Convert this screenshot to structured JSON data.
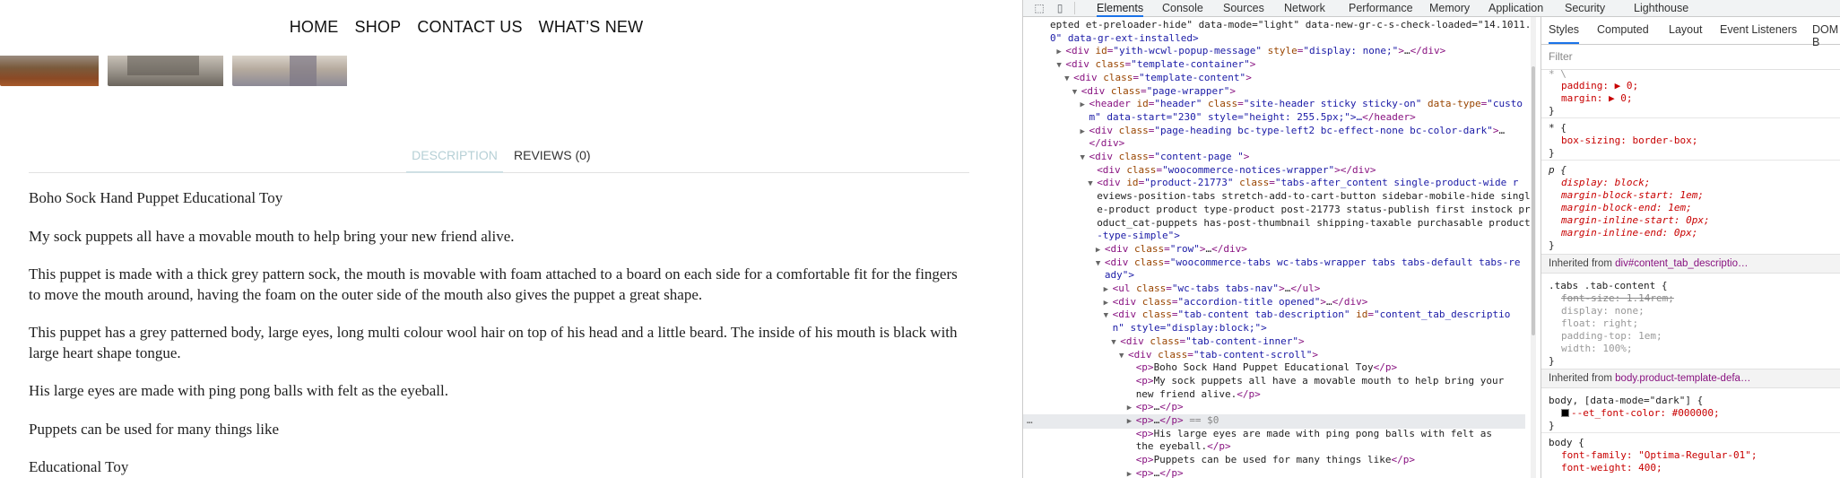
{
  "site": {
    "nav": [
      "HOME",
      "SHOP",
      "CONTACT US",
      "WHAT’S NEW"
    ],
    "tabs": {
      "description": "DESCRIPTION",
      "reviews": "REVIEWS (0)"
    },
    "paragraphs": [
      "Boho Sock Hand Puppet Educational Toy",
      "My sock puppets all have a movable mouth to help bring your new friend alive.",
      "This puppet is made with a thick grey pattern sock, the mouth is movable with foam attached to a board on each side for a comfortable fit for the fingers to move the mouth around, having the foam on the outer side of the mouth also gives the puppet a great shape.",
      "This puppet has a grey patterned body, large eyes, long multi colour wool hair on top of his head and a little beard. The inside of his mouth is black with large heart shape tongue.",
      "His large eyes are made with ping pong balls with felt as the eyeball.",
      "Puppets can be used for many things like",
      "Educational Toy"
    ]
  },
  "devtools": {
    "toolbar_tabs": [
      "Elements",
      "Console",
      "Sources",
      "Network",
      "Performance",
      "Memory",
      "Application",
      "Security",
      "Lighthouse"
    ],
    "toolbar_icons": [
      "inspect-icon",
      "device-toggle-icon"
    ],
    "dom_lines": [
      {
        "indent": 0,
        "arrow": "",
        "html": "epted et-preloader-hide\" data-mode=\"light\" data-new-gr-c-s-check-loaded=\"14.1011."
      },
      {
        "indent": 0,
        "arrow": "",
        "html": "0\" data-gr-ext-installed>"
      },
      {
        "indent": 2,
        "arrow": "▶",
        "html": "<div id=\"yith-wcwl-popup-message\" style=\"display: none;\">…</div>"
      },
      {
        "indent": 2,
        "arrow": "▼",
        "html": "<div class=\"template-container\">"
      },
      {
        "indent": 3,
        "arrow": "▼",
        "html": "<div class=\"template-content\">"
      },
      {
        "indent": 4,
        "arrow": "▼",
        "html": "<div class=\"page-wrapper\">"
      },
      {
        "indent": 5,
        "arrow": "▶",
        "html": "<header id=\"header\" class=\"site-header sticky sticky-on\" data-type=\"custo"
      },
      {
        "indent": 5,
        "arrow": "",
        "html": "m\" data-start=\"230\" style=\"height: 255.5px;\">…</header>"
      },
      {
        "indent": 5,
        "arrow": "▶",
        "html": "<div class=\"page-heading bc-type-left2 bc-effect-none bc-color-dark\">…"
      },
      {
        "indent": 5,
        "arrow": "",
        "html": "</div>"
      },
      {
        "indent": 5,
        "arrow": "▼",
        "html": "<div class=\"content-page \">"
      },
      {
        "indent": 6,
        "arrow": "",
        "html": "<div class=\"woocommerce-notices-wrapper\"></div>"
      },
      {
        "indent": 6,
        "arrow": "▼",
        "html": "<div id=\"product-21773\" class=\"tabs-after_content single-product-wide r"
      },
      {
        "indent": 6,
        "arrow": "",
        "html": "eviews-position-tabs stretch-add-to-cart-button sidebar-mobile-hide singl"
      },
      {
        "indent": 6,
        "arrow": "",
        "html": "e-product product type-product post-21773 status-publish first instock pr"
      },
      {
        "indent": 6,
        "arrow": "",
        "html": "oduct_cat-puppets has-post-thumbnail shipping-taxable purchasable product"
      },
      {
        "indent": 6,
        "arrow": "",
        "html": "-type-simple\">"
      },
      {
        "indent": 7,
        "arrow": "▶",
        "html": "<div class=\"row\">…</div>"
      },
      {
        "indent": 7,
        "arrow": "▼",
        "html": "<div class=\"woocommerce-tabs wc-tabs-wrapper tabs tabs-default tabs-re"
      },
      {
        "indent": 7,
        "arrow": "",
        "html": "ady\">"
      },
      {
        "indent": 8,
        "arrow": "▶",
        "html": "<ul class=\"wc-tabs tabs-nav\">…</ul>"
      },
      {
        "indent": 8,
        "arrow": "▶",
        "html": "<div class=\"accordion-title opened\">…</div>"
      },
      {
        "indent": 8,
        "arrow": "▼",
        "html": "<div class=\"tab-content tab-description\" id=\"content_tab_descriptio"
      },
      {
        "indent": 8,
        "arrow": "",
        "html": "n\" style=\"display:block;\">"
      },
      {
        "indent": 9,
        "arrow": "▼",
        "html": "<div class=\"tab-content-inner\">"
      },
      {
        "indent": 10,
        "arrow": "▼",
        "html": "<div class=\"tab-content-scroll\">"
      },
      {
        "indent": 11,
        "arrow": "",
        "html": "<p>Boho Sock Hand Puppet Educational Toy</p>"
      },
      {
        "indent": 11,
        "arrow": "",
        "html": "<p>My sock puppets all have a movable mouth to help bring your"
      },
      {
        "indent": 11,
        "arrow": "",
        "html": "new friend alive.</p>"
      },
      {
        "indent": 11,
        "arrow": "▶",
        "html": "<p>…</p>"
      },
      {
        "indent": 11,
        "arrow": "▶",
        "html": "<p>…</p> == $0",
        "selected": true
      },
      {
        "indent": 11,
        "arrow": "",
        "html": "<p>His large eyes are made with ping pong balls with felt as"
      },
      {
        "indent": 11,
        "arrow": "",
        "html": "the eyeball.</p>"
      },
      {
        "indent": 11,
        "arrow": "",
        "html": "<p>Puppets can be used for many things like</p>"
      },
      {
        "indent": 11,
        "arrow": "▶",
        "html": "<p>…</p>"
      }
    ],
    "styles_tabs": [
      "Styles",
      "Computed",
      "Layout",
      "Event Listeners",
      "DOM B"
    ],
    "filter_placeholder": "Filter",
    "style_rules": {
      "top_partial": [
        "padding: ▶ 0;",
        "margin: ▶ 0;"
      ],
      "universal": {
        "selector": "* {",
        "props": [
          "box-sizing: border-box;"
        ]
      },
      "p_rule": {
        "selector": "p {",
        "props": [
          "display: block;",
          "margin-block-start: 1em;",
          "margin-block-end: 1em;",
          "margin-inline-start: 0px;",
          "margin-inline-end: 0px;"
        ]
      },
      "inherited1": {
        "prefix": "Inherited from ",
        "target": "div#content_tab_descriptio…"
      },
      "tabs_rule": {
        "selector": ".tabs .tab-content {",
        "props": [
          "font-size: 1.14rem;",
          "display: none;",
          "float: right;",
          "padding-top: 1em;",
          "width: 100%;"
        ]
      },
      "inherited2": {
        "prefix": "Inherited from ",
        "target": "body.product-template-defa…"
      },
      "body_dark": {
        "selector": "body, [data-mode=\"dark\"] {",
        "props": [
          "--et_font-color: #000000;"
        ]
      },
      "body_rule": {
        "selector": "body {",
        "props": [
          "font-family: \"Optima-Regular-01\";",
          "font-weight: 400;"
        ]
      }
    }
  }
}
